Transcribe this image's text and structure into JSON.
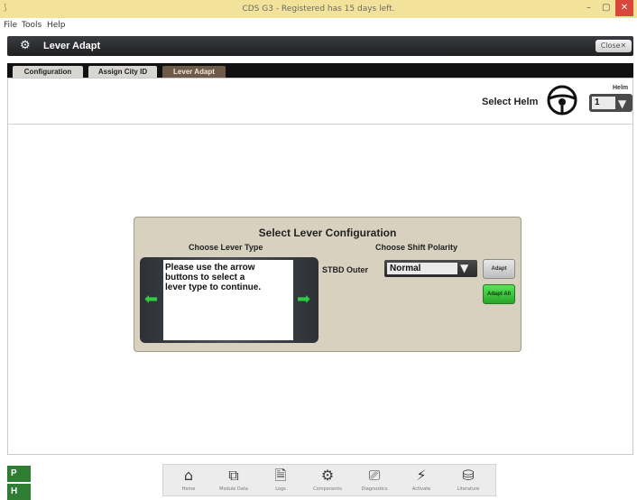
{
  "window": {
    "title": "CDS G3 - Registered has 15 days left.",
    "controls": {
      "minimize": "–",
      "maximize": "▢",
      "close": "✕"
    }
  },
  "menu": {
    "items": [
      "File",
      "Tools",
      "Help"
    ]
  },
  "header": {
    "title": "Lever Adapt",
    "close_label": "Close✕"
  },
  "tabs": [
    {
      "label": "Configuration"
    },
    {
      "label": "Assign City ID"
    },
    {
      "label": "Lever Adapt"
    }
  ],
  "helm": {
    "label": "Select Helm",
    "select_label": "Helm",
    "value": "1"
  },
  "lever_dialog": {
    "title": "Select Lever Configuration",
    "lever_type_heading": "Choose Lever Type",
    "polarity_heading": "Choose Shift Polarity",
    "instructions": "Please use the arrow buttons to select a lever type to continue.",
    "stbd_label": "STBD Outer",
    "polarity_value": "Normal",
    "adapt_label": "Adapt",
    "adapt_all_label": "Adapt All"
  },
  "badges": {
    "p": "P",
    "h": "H"
  },
  "nav": {
    "items": [
      {
        "label": "Home",
        "icon": "home-icon"
      },
      {
        "label": "Module Data",
        "icon": "module-data-icon"
      },
      {
        "label": "Logs",
        "icon": "logs-icon"
      },
      {
        "label": "Components",
        "icon": "components-icon"
      },
      {
        "label": "Diagnostics",
        "icon": "diagnostics-icon"
      },
      {
        "label": "Activate",
        "icon": "activate-icon"
      },
      {
        "label": "Literature",
        "icon": "literature-icon"
      }
    ]
  },
  "colors": {
    "accent_green": "#2ecc40",
    "titlebar": "#f3e39a",
    "dialog_bg": "#d9d1bf",
    "active_tab": "#6e5a49"
  }
}
